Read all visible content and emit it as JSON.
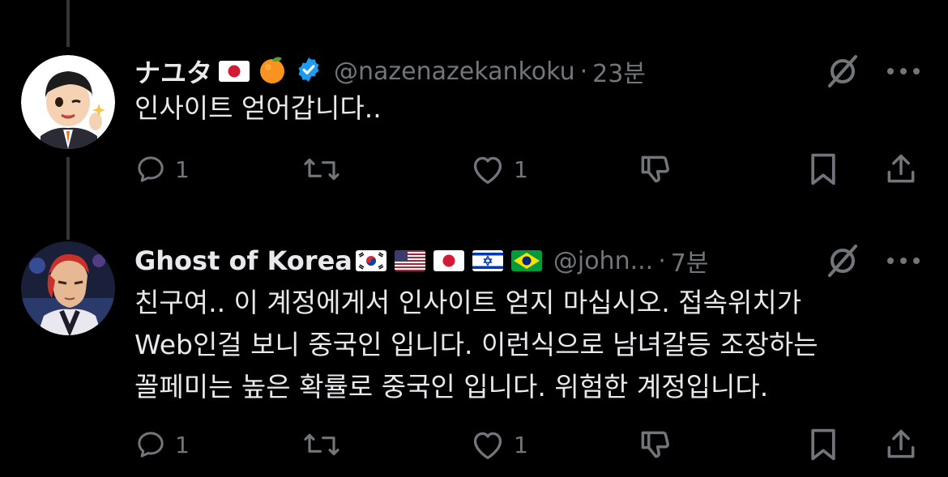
{
  "tweets": [
    {
      "name": "ナユタ",
      "name_emojis": [
        "japan-flag",
        "orange-emoji"
      ],
      "verified": true,
      "handle": "@nazenazekankoku",
      "separator": "·",
      "time": "23분",
      "text": "인사이트 얻어갑니다..",
      "actions": {
        "reply_count": "1",
        "retweet_count": "",
        "like_count": "1"
      }
    },
    {
      "name": "Ghost of Korea",
      "name_emojis": [
        "korea-flag",
        "usa-flag",
        "japan-flag",
        "israel-flag",
        "brazil-flag"
      ],
      "verified": false,
      "handle": "@john...",
      "separator": "·",
      "time": "7분",
      "text": "친구여.. 이 계정에게서 인사이트 얻지 마십시오. 접속위치가\nWeb인걸 보니 중국인 입니다. 이런식으로 남녀갈등 조장하는\n꼴페미는 높은 확률로 중국인 입니다. 위험한 계정입니다.",
      "actions": {
        "reply_count": "1",
        "retweet_count": "",
        "like_count": "1"
      }
    }
  ],
  "colors": {
    "background": "#000000",
    "text": "#e7e9ea",
    "muted": "#71767b",
    "verified": "#1d9bf0"
  }
}
